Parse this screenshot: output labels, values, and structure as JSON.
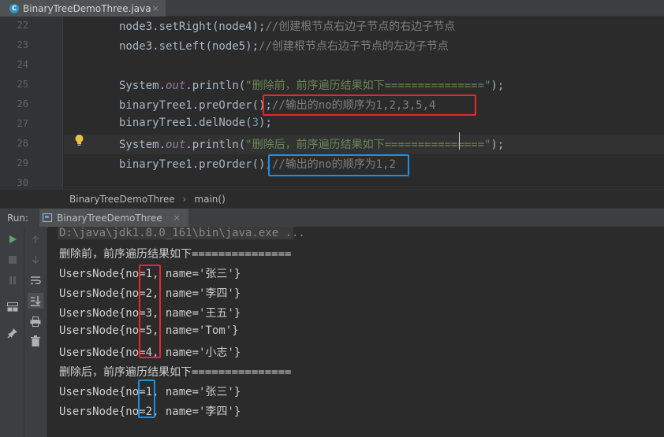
{
  "editor_tab": {
    "title": "BinaryTreeDemoThree.java",
    "close": "×"
  },
  "editor": {
    "lines": [
      {
        "n": "22",
        "code": "node3.setRight(node4);",
        "comment": "//创建根节点右边子节点的右边子节点"
      },
      {
        "n": "23",
        "code": "node3.setLeft(node5);",
        "comment": "//创建根节点右边子节点的左边子节点"
      },
      {
        "n": "24"
      },
      {
        "n": "25",
        "pre": "System.",
        "field": "out",
        "mid": ".println(",
        "str": "\"删除前，前序遍历结果如下===============\"",
        "post": ");"
      },
      {
        "n": "26",
        "code": "binaryTree1.preOrder();",
        "comment": "//输出的no的顺序为1,2,3,5,4"
      },
      {
        "n": "27",
        "pre": "binaryTree1.delNode(",
        "num": "3",
        "post": ");"
      },
      {
        "n": "28",
        "pre": "System.",
        "field": "out",
        "mid": ".println(",
        "str": "\"删除后，前序遍历结果如下===============\"",
        "post": ");"
      },
      {
        "n": "29",
        "code": "binaryTree1.preOrder();",
        "comment": "//输出的no的顺序为1,2"
      },
      {
        "n": "30"
      }
    ]
  },
  "breadcrumb": {
    "class": "BinaryTreeDemoThree",
    "separator": "›",
    "method": "main()"
  },
  "run_panel": {
    "label": "Run:",
    "tab": "BinaryTreeDemoThree",
    "close": "×",
    "console": [
      "D:\\java\\jdk1.8.0_161\\bin\\java.exe ...",
      "删除前，前序遍历结果如下===============",
      "UsersNode{no=1, name='张三'}",
      "UsersNode{no=2, name='李四'}",
      "UsersNode{no=3, name='王五'}",
      "UsersNode{no=5, name='Tom'}",
      "UsersNode{no=4, name='小志'}",
      "删除后，前序遍历结果如下===============",
      "UsersNode{no=1, name='张三'}",
      "UsersNode{no=2, name='李四'}"
    ]
  },
  "icons": {
    "file": "java-class-icon",
    "bulb": "lightbulb-icon",
    "run": "run-icon",
    "stop": "stop-icon",
    "pause": "pause-icon",
    "up": "up-arrow-icon",
    "down": "down-arrow-icon",
    "wrap": "soft-wrap-icon",
    "scroll": "scroll-to-end-icon",
    "layout": "layout-icon",
    "print": "print-icon",
    "pin": "pin-icon",
    "trash": "trash-icon"
  },
  "colors": {
    "annotation_red": "#e8282b",
    "annotation_blue": "#1f8fe6",
    "string": "#6a8759",
    "comment": "#808080",
    "field": "#9876aa",
    "number": "#6897bb"
  }
}
